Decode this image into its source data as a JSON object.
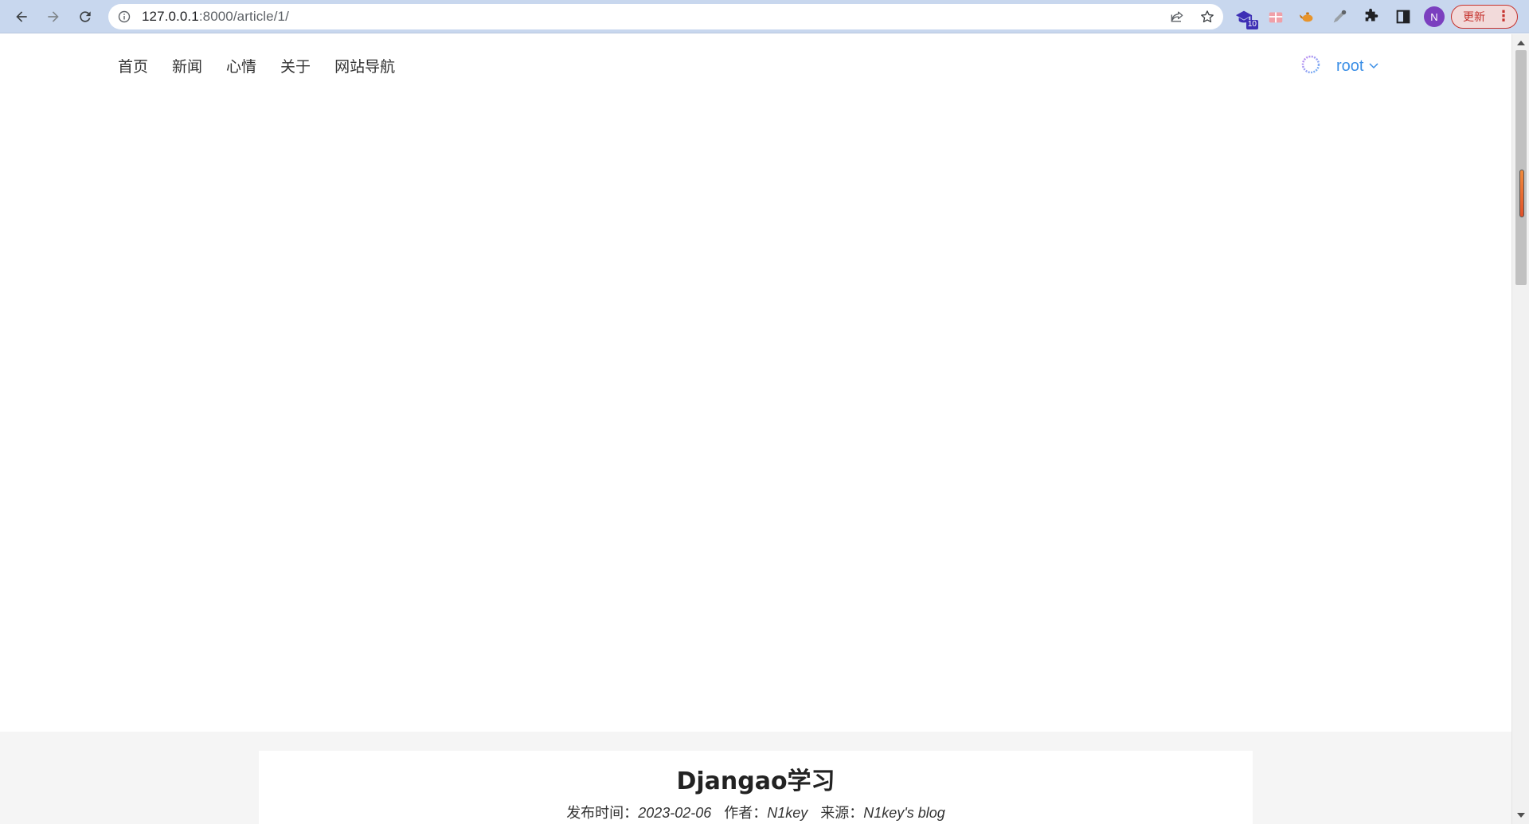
{
  "browser": {
    "url_host": "127.0.0.1",
    "url_rest": ":8000/article/1/",
    "extension_badge": "10",
    "profile_initial": "N",
    "update_label": "更新",
    "menu_glyph": "⋮"
  },
  "icons": {
    "back": "back-arrow-icon",
    "forward": "forward-arrow-icon",
    "reload": "reload-icon",
    "site_info": "info-icon",
    "share": "share-icon",
    "bookmark": "star-icon",
    "extensions": [
      "graduation-cap-icon",
      "gift-icon",
      "teapot-icon",
      "eyedropper-icon",
      "puzzle-icon",
      "side-panel-icon"
    ],
    "user_spinner": "loading-ring-icon",
    "user_caret": "chevron-down-icon"
  },
  "site": {
    "nav": [
      {
        "label": "首页"
      },
      {
        "label": "新闻"
      },
      {
        "label": "心情"
      },
      {
        "label": "关于"
      },
      {
        "label": "网站导航"
      }
    ],
    "user": "root",
    "accent_color": "#3a8ee6"
  },
  "article": {
    "title": "Djangao学习",
    "publish_label": "发布时间：",
    "publish_date": "2023-02-06",
    "author_label": "作者：",
    "author": "N1key",
    "source_label": "来源：",
    "source": "N1key's blog"
  }
}
